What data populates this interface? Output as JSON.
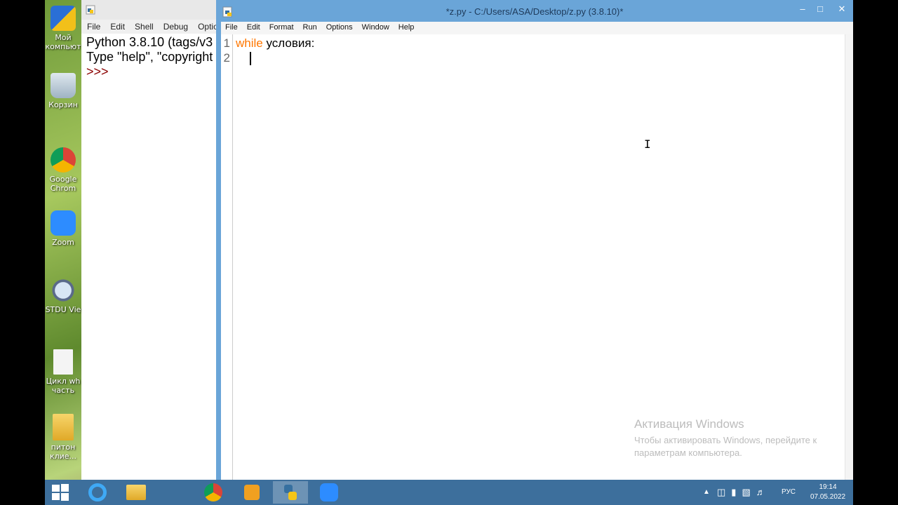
{
  "desktop": {
    "icons": [
      {
        "label": "Мой компьют",
        "name": "my-computer-icon"
      },
      {
        "label": "Корзин",
        "name": "recycle-bin-icon"
      },
      {
        "label": "Google Chrom",
        "name": "chrome-icon"
      },
      {
        "label": "Zoom",
        "name": "zoom-icon"
      },
      {
        "label": "STDU Vie",
        "name": "stdu-viewer-icon"
      },
      {
        "label": "Цикл wh часть",
        "name": "document-icon"
      },
      {
        "label": "питон клие...",
        "name": "folder-icon"
      }
    ]
  },
  "shell": {
    "menu": [
      "File",
      "Edit",
      "Shell",
      "Debug",
      "Options"
    ],
    "line1": "Python 3.8.10 (tags/v3",
    "line2": "Type \"help\", \"copyright",
    "prompt": ">>>"
  },
  "editor": {
    "title": "*z.py - C:/Users/ASA/Desktop/z.py (3.8.10)*",
    "menu": [
      "File",
      "Edit",
      "Format",
      "Run",
      "Options",
      "Window",
      "Help"
    ],
    "line_numbers": [
      "1",
      "2"
    ],
    "code_keyword": "while",
    "code_rest": " условия:",
    "colors": {
      "keyword": "#ff7700",
      "titlebar": "#6aa5d8"
    }
  },
  "watermark": {
    "heading": "Активация Windows",
    "line1": "Чтобы активировать Windows, перейдите к",
    "line2": "параметрам компьютера."
  },
  "taskbar": {
    "language": "РУС",
    "time": "19:14",
    "date": "07.05.2022"
  }
}
